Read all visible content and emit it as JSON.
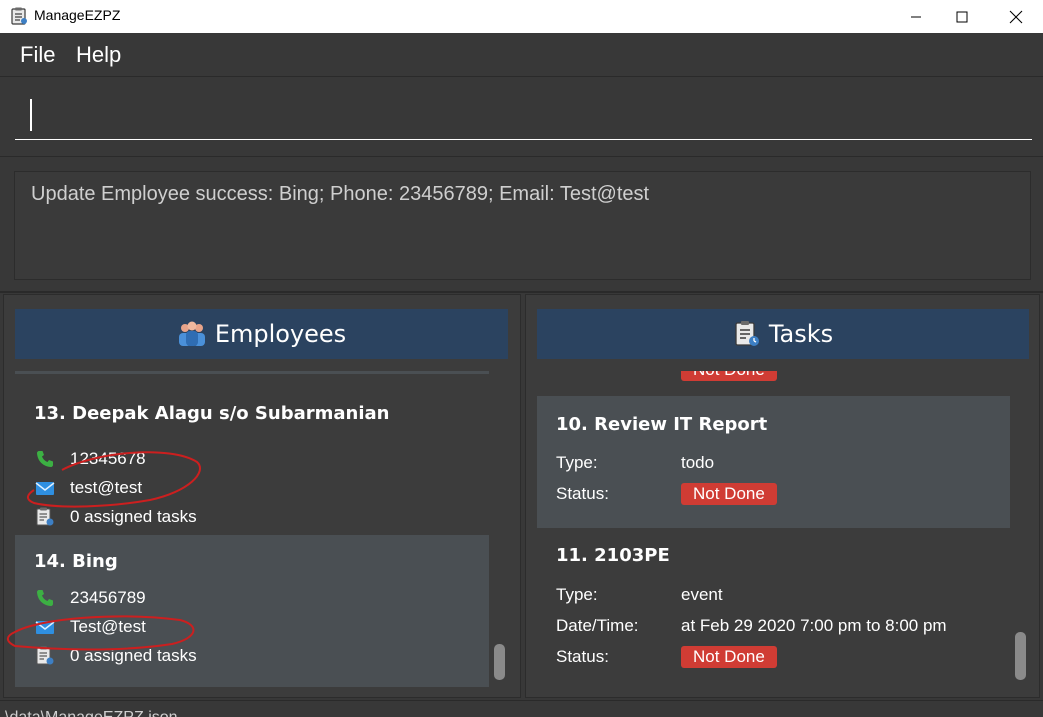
{
  "window": {
    "title": "ManageEZPZ"
  },
  "menu": {
    "file": "File",
    "help": "Help"
  },
  "command": {
    "value": "",
    "placeholder": ""
  },
  "result": {
    "text": "Update Employee success: Bing; Phone: 23456789; Email: Test@test"
  },
  "employees": {
    "title": "Employees",
    "cards": [
      {
        "name": "13.  Deepak Alagu s/o Subarmanian",
        "phone": "12345678",
        "email": "test@test",
        "tasks": "0 assigned tasks"
      },
      {
        "name": "14.  Bing",
        "phone": "23456789",
        "email": "Test@test",
        "tasks": "0 assigned tasks"
      }
    ]
  },
  "tasks": {
    "title": "Tasks",
    "partial_badge": "Not Done",
    "cards": [
      {
        "name": "10.  Review IT Report",
        "type_label": "Type:",
        "type": "todo",
        "status_label": "Status:",
        "status": "Not Done"
      },
      {
        "name": "11.  2103PE",
        "type_label": "Type:",
        "type": "event",
        "datetime_label": "Date/Time:",
        "datetime": "at Feb 29 2020 7:00 pm to 8:00 pm",
        "status_label": "Status:",
        "status": "Not Done"
      }
    ]
  },
  "statusbar": {
    "path": "\\data\\ManageEZPZ.json"
  },
  "colors": {
    "background": "#383838",
    "header": "#2b4360",
    "card_selected": "#4a4f53",
    "card_normal": "#3c3c3c",
    "badge_not_done": "#d03c34",
    "annotation": "#cc1f1f"
  },
  "icons": {
    "app": "app-clipboard-icon",
    "employees": "employees-group-icon",
    "tasks": "tasks-clipboard-icon",
    "phone": "phone-icon",
    "email": "email-envelope-icon",
    "assigned_tasks": "assigned-tasks-icon"
  }
}
